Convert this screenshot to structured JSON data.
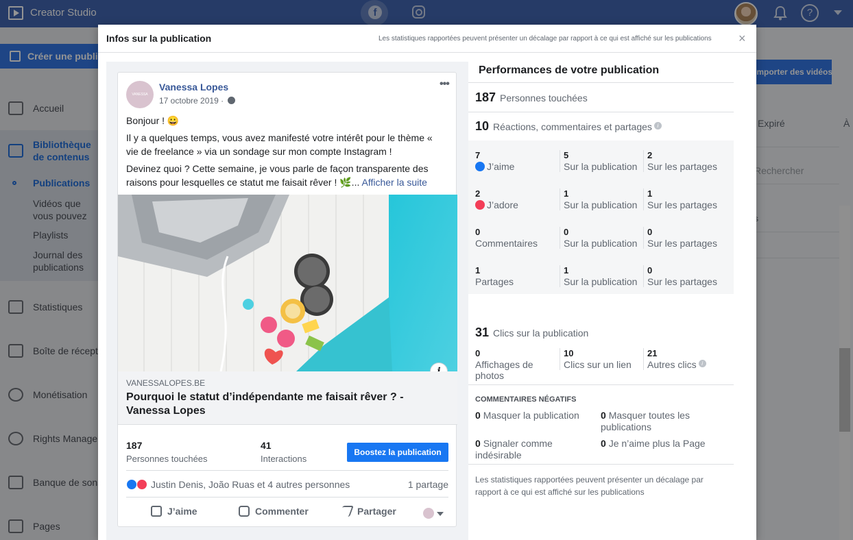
{
  "app": {
    "title": "Creator Studio"
  },
  "sidebar": {
    "create_label": "Créer une publication",
    "items": [
      {
        "label": "Accueil"
      },
      {
        "label": "Bibliothèque de contenus"
      },
      {
        "label": "Publications"
      },
      {
        "label": "Vidéos que vous pouvez crosspublier"
      },
      {
        "label": "Playlists"
      },
      {
        "label": "Journal des publications"
      },
      {
        "label": "Statistiques"
      },
      {
        "label": "Boîte de réception"
      },
      {
        "label": "Monétisation"
      },
      {
        "label": "Rights Manager"
      },
      {
        "label": "Banque de sons"
      },
      {
        "label": "Pages"
      }
    ]
  },
  "background": {
    "export_label": "Importer des vidéos",
    "col_expired": "Expiré",
    "col_a": "À",
    "search_placeholder": "Rechercher",
    "row_s": "s"
  },
  "modal": {
    "title": "Infos sur la publication",
    "note": "Les statistiques rapportées peuvent présenter un décalage par rapport à ce qui est affiché sur les publications",
    "close": "×"
  },
  "post": {
    "author": "Vanessa Lopes",
    "avatar_text": "VANESSA LOPES",
    "date": "17 octobre 2019 ·",
    "more": "•••",
    "p1": "Bonjour ! 😀",
    "p2": "Il y a quelques temps, vous avez manifesté votre intérêt pour le thème « vie de freelance » via un sondage sur mon compte Instagram !",
    "p3": "Devinez quoi ? Cette semaine, je vous parle de façon transparente des raisons pour lesquelles ce statut me faisait rêver ! 🌿...",
    "see_more": "Afficher la suite",
    "info_icon": "i",
    "link_domain": "VANESSALOPES.BE",
    "link_title": "Pourquoi le statut d’indépendante me faisait rêver ? - Vanessa Lopes",
    "reach_value": "187",
    "reach_label": "Personnes touchées",
    "interactions_value": "41",
    "interactions_label": "Interactions",
    "boost_label": "Boostez la publication",
    "reactors": "Justin Denis, João Ruas et 4 autres personnes",
    "shares": "1 partage",
    "action_like": "J’aime",
    "action_comment": "Commenter",
    "action_share": "Partager"
  },
  "performance": {
    "title": "Performances de votre publication",
    "reach_value": "187",
    "reach_label": "Personnes touchées",
    "engagement_value": "10",
    "engagement_label": "Réactions, commentaires et partages",
    "rows": [
      {
        "total": "7",
        "label": "J’aime",
        "on_post": "5",
        "on_shares": "2"
      },
      {
        "total": "2",
        "label": "J’adore",
        "on_post": "1",
        "on_shares": "1"
      },
      {
        "total": "0",
        "label": "Commentaires",
        "on_post": "0",
        "on_shares": "0"
      },
      {
        "total": "1",
        "label": "Partages",
        "on_post": "1",
        "on_shares": "0"
      }
    ],
    "on_post_label": "Sur la publication",
    "on_shares_label": "Sur les partages",
    "clicks_value": "31",
    "clicks_label": "Clics sur la publication",
    "photo_views_value": "0",
    "photo_views_label": "Affichages de photos",
    "link_clicks_value": "10",
    "link_clicks_label": "Clics sur un lien",
    "other_clicks_value": "21",
    "other_clicks_label": "Autres clics",
    "negative_title": "COMMENTAIRES NÉGATIFS",
    "neg_hide_post_value": "0",
    "neg_hide_post_label": "Masquer la publication",
    "neg_hide_all_value": "0",
    "neg_hide_all_label": "Masquer toutes les publications",
    "neg_spam_value": "0",
    "neg_spam_label": "Signaler comme indésirable",
    "neg_unlike_value": "0",
    "neg_unlike_label": "Je n’aime plus la Page",
    "footnote": "Les statistiques rapportées peuvent présenter un décalage par rapport à ce qui est affiché sur les publications"
  },
  "colors": {
    "brand": "#4267b2",
    "accent": "#1877f2",
    "love": "#f33e58"
  }
}
